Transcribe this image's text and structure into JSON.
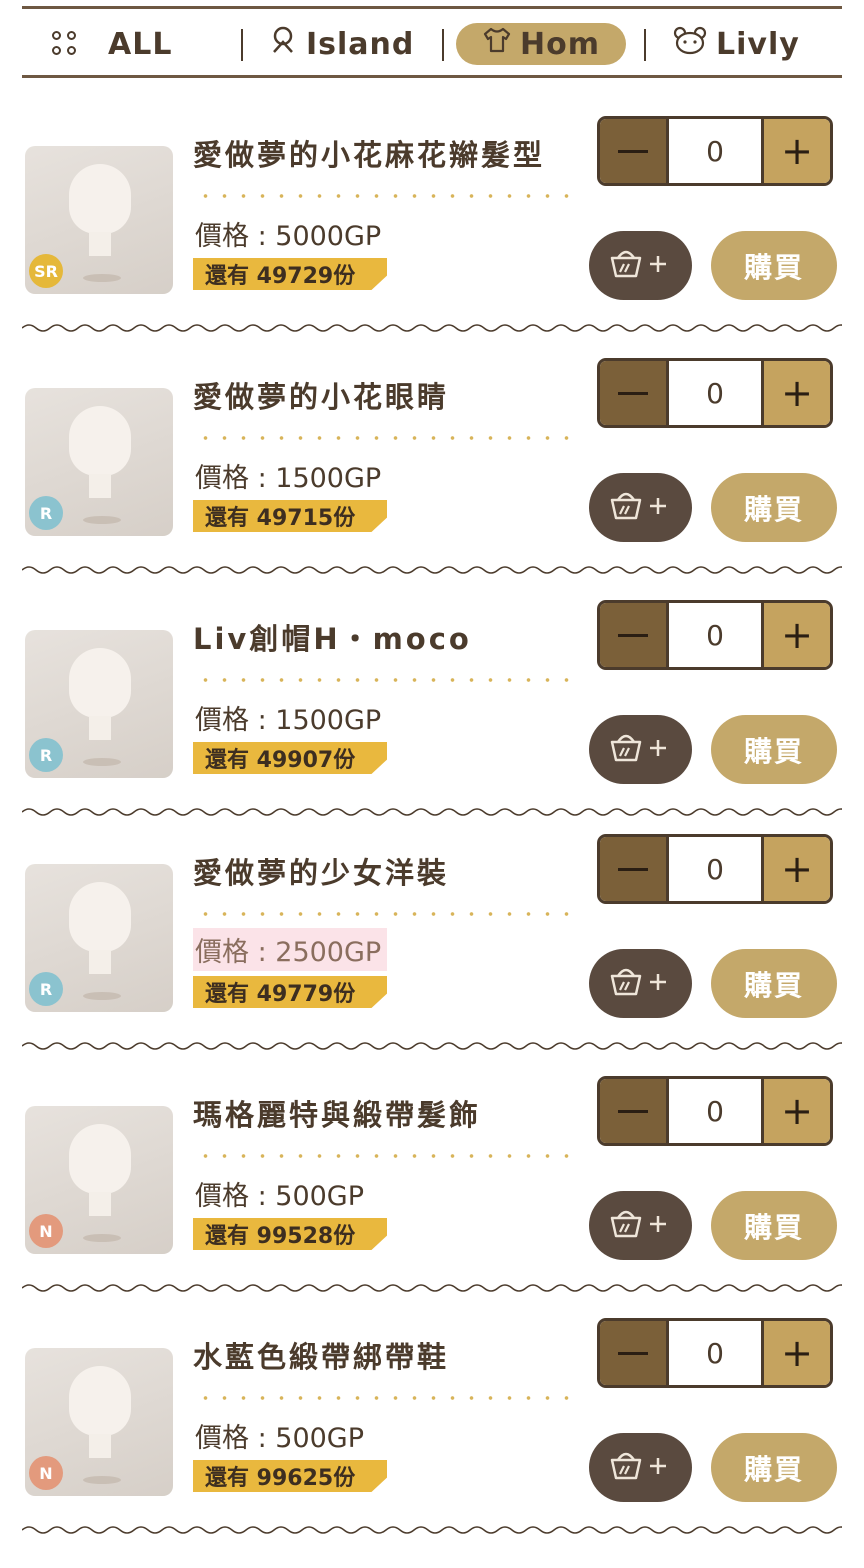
{
  "tabs": [
    {
      "label": "ALL",
      "icon": "grid-dots-icon"
    },
    {
      "label": "Island",
      "icon": "island-tree-icon"
    },
    {
      "label": "Hom",
      "icon": "shirt-icon",
      "active": true
    },
    {
      "label": "Livly",
      "icon": "livly-face-icon"
    }
  ],
  "colors": {
    "accent": "#c4a86a",
    "dark_brown": "#4b3b2c",
    "stock_yellow": "#e9b83e",
    "cart_button": "#5a4a3f",
    "rarity_sr": "#e5b83a",
    "rarity_r": "#8bc3cf",
    "rarity_n": "#e39a7d",
    "price_highlight": "#fbe3e8"
  },
  "items": [
    {
      "name": "愛做夢的小花麻花辮髮型",
      "price": "價格 : 5000GP",
      "stock": "還有 49729份",
      "rarity": "SR",
      "quantity": "0",
      "buy_label": "購買",
      "cart_icon": "basket-plus-icon"
    },
    {
      "name": "愛做夢的小花眼睛",
      "price": "價格 : 1500GP",
      "stock": "還有 49715份",
      "rarity": "R",
      "quantity": "0",
      "buy_label": "購買",
      "cart_icon": "basket-plus-icon"
    },
    {
      "name": "Liv創帽H・moco",
      "price": "價格 : 1500GP",
      "stock": "還有 49907份",
      "rarity": "R",
      "quantity": "0",
      "buy_label": "購買",
      "cart_icon": "basket-plus-icon"
    },
    {
      "name": "愛做夢的少女洋裝",
      "price": "價格 : 2500GP",
      "stock": "還有 49779份",
      "rarity": "R",
      "quantity": "0",
      "buy_label": "購買",
      "cart_icon": "basket-plus-icon",
      "price_highlighted": true
    },
    {
      "name": "瑪格麗特與緞帶髮飾",
      "price": "價格 : 500GP",
      "stock": "還有 99528份",
      "rarity": "N",
      "quantity": "0",
      "buy_label": "購買",
      "cart_icon": "basket-plus-icon"
    },
    {
      "name": "水藍色緞帶綁帶鞋",
      "price": "價格 : 500GP",
      "stock": "還有 99625份",
      "rarity": "N",
      "quantity": "0",
      "buy_label": "購買",
      "cart_icon": "basket-plus-icon"
    }
  ]
}
